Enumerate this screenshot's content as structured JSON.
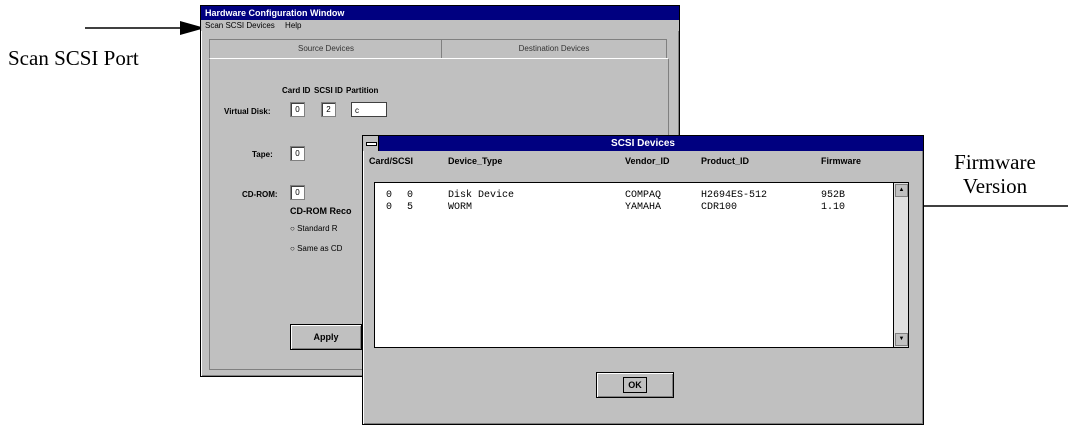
{
  "callouts": {
    "scan": "Scan SCSI Port",
    "firmware_line1": "Firmware",
    "firmware_line2": "Version"
  },
  "main_window": {
    "title": "Hardware Configuration Window",
    "menu": [
      "Scan SCSI Devices",
      "Help"
    ],
    "tabs": [
      "Source Devices",
      "Destination Devices"
    ],
    "column_labels": [
      "Card ID",
      "SCSI ID",
      "Partition"
    ],
    "rows": {
      "virtual_disk": {
        "label": "Virtual Disk:",
        "card_id": "0",
        "scsi_id": "2",
        "partition": "c"
      },
      "tape": {
        "label": "Tape:",
        "card_id": "0"
      },
      "cdrom": {
        "label": "CD-ROM:",
        "card_id": "0"
      }
    },
    "cdrom_recorder_label": "CD-ROM Reco",
    "radio_standard": "Standard R",
    "radio_same": "Same as CD",
    "apply_label": "Apply"
  },
  "scsi_dialog": {
    "title": "SCSI Devices",
    "columns": [
      "Card/SCSI",
      "Device_Type",
      "Vendor_ID",
      "Product_ID",
      "Firmware"
    ],
    "rows": [
      {
        "card": "0",
        "scsi": "0",
        "device_type": "Disk Device",
        "vendor": "COMPAQ",
        "product": "H2694ES-512",
        "firmware": "952B"
      },
      {
        "card": "0",
        "scsi": "5",
        "device_type": "WORM",
        "vendor": "YAMAHA",
        "product": "CDR100",
        "firmware": "1.10"
      }
    ],
    "ok_label": "OK"
  }
}
